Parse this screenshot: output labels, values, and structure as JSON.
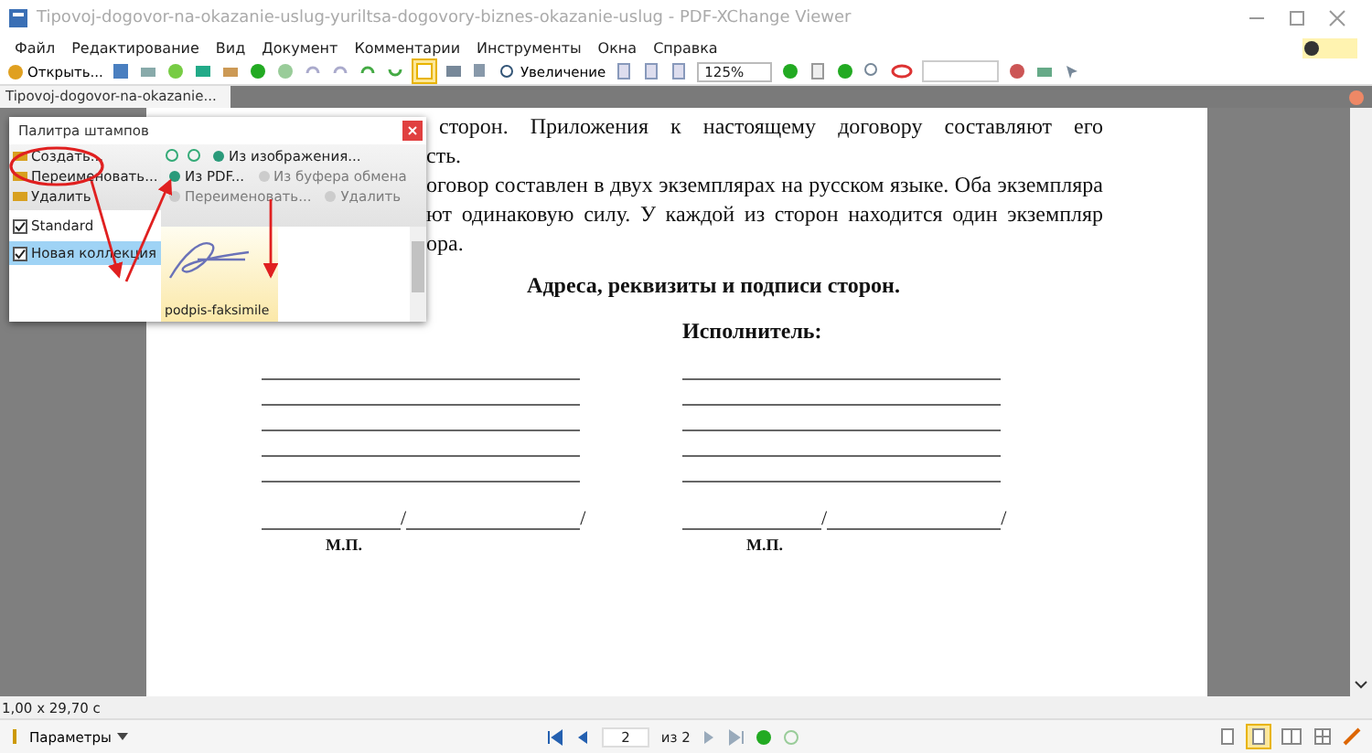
{
  "window": {
    "title": "Tipovoj-dogovor-na-okazanie-uslug-yuriltsa-dogovory-biznes-okazanie-uslug - PDF-XChange Viewer"
  },
  "menu": [
    "Файл",
    "Редактирование",
    "Вид",
    "Документ",
    "Комментарии",
    "Инструменты",
    "Окна",
    "Справка"
  ],
  "toolbar": {
    "open_label": "Открыть...",
    "zoom_label": "Увеличение",
    "zoom_value": "125%"
  },
  "tabs": [
    {
      "label": "Tipovoj-dogovor-na-okazanie...",
      "selected": true
    }
  ],
  "document": {
    "lines": [
      {
        "text": "сторон. Приложения к настоящему договору составляют его",
        "kind": "full"
      },
      {
        "text": "сть.",
        "kind": "end"
      },
      {
        "text": "оговор составлен в двух экземплярах на русском языке. Оба экземпляра",
        "kind": "full"
      },
      {
        "text": "ют одинаковую силу. У каждой из сторон находится один экземпляр",
        "kind": "full"
      },
      {
        "text": "ора.",
        "kind": "end"
      }
    ],
    "heading": "Адреса, реквизиты и подписи сторон.",
    "parties": [
      {
        "slash_1": "/",
        "slash_2": "/",
        "stamp": "М.П."
      },
      {
        "label": "Исполнитель:",
        "slash_1": "/",
        "slash_2": "/",
        "stamp": "М.П."
      }
    ]
  },
  "stamp_palette": {
    "title": "Палитра штампов",
    "collection_actions": [
      {
        "label": "Создать...",
        "disabled": false
      },
      {
        "label": "Переименовать...",
        "disabled": false
      },
      {
        "label": "Удалить",
        "disabled": false
      }
    ],
    "collections": [
      {
        "label": "Standard",
        "checked": true,
        "selected": false
      },
      {
        "label": "Новая коллекция",
        "checked": true,
        "selected": true
      }
    ],
    "stamp_actions": [
      {
        "label": "Из изображения...",
        "disabled": false
      },
      {
        "label": "Из PDF...",
        "disabled": false
      },
      {
        "label": "Из буфера обмена",
        "disabled": true
      },
      {
        "label": "Переименовать...",
        "disabled": true
      },
      {
        "label": "Удалить",
        "disabled": true
      }
    ],
    "stamps": [
      {
        "label": "podpis-faksimile",
        "selected": true
      }
    ]
  },
  "status_bar": {
    "page_size": "1,00 x 29,70 с",
    "options": "Параметры",
    "page": "2",
    "page_total": "из 2"
  }
}
